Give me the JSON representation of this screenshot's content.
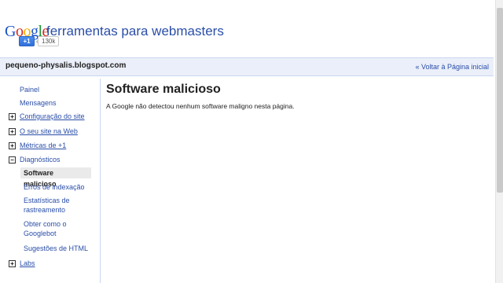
{
  "header": {
    "logo_letters": [
      "G",
      "o",
      "o",
      "g",
      "l",
      "e"
    ],
    "product_name": "ferramentas para webmasters",
    "plusone_label": "+1",
    "plusone_count": "130k"
  },
  "sitebar": {
    "site_url": "pequeno-physalis.blogspot.com",
    "back_link": "« Voltar à Página inicial"
  },
  "sidebar": {
    "items": [
      {
        "label": "Painel"
      },
      {
        "label": "Mensagens"
      },
      {
        "label": "Configuração do site",
        "toggle": "+"
      },
      {
        "label": "O seu site na Web",
        "toggle": "+"
      },
      {
        "label": "Métricas de +1",
        "toggle": "+"
      },
      {
        "label": "Diagnósticos",
        "toggle": "−"
      },
      {
        "label": "Software malicioso"
      },
      {
        "label": "Erros de indexação"
      },
      {
        "label": "Estatísticas de rastreamento"
      },
      {
        "label": "Obter como o Googlebot"
      },
      {
        "label": "Sugestões de HTML"
      },
      {
        "label": "Labs",
        "toggle": "+"
      }
    ]
  },
  "main": {
    "title": "Software malicioso",
    "message": "A Google não detectou nenhum software maligno nesta página."
  },
  "colors": {
    "link": "#2a4ea8",
    "sitebar_bg": "#ebeff9",
    "border": "#c9d7f1"
  }
}
